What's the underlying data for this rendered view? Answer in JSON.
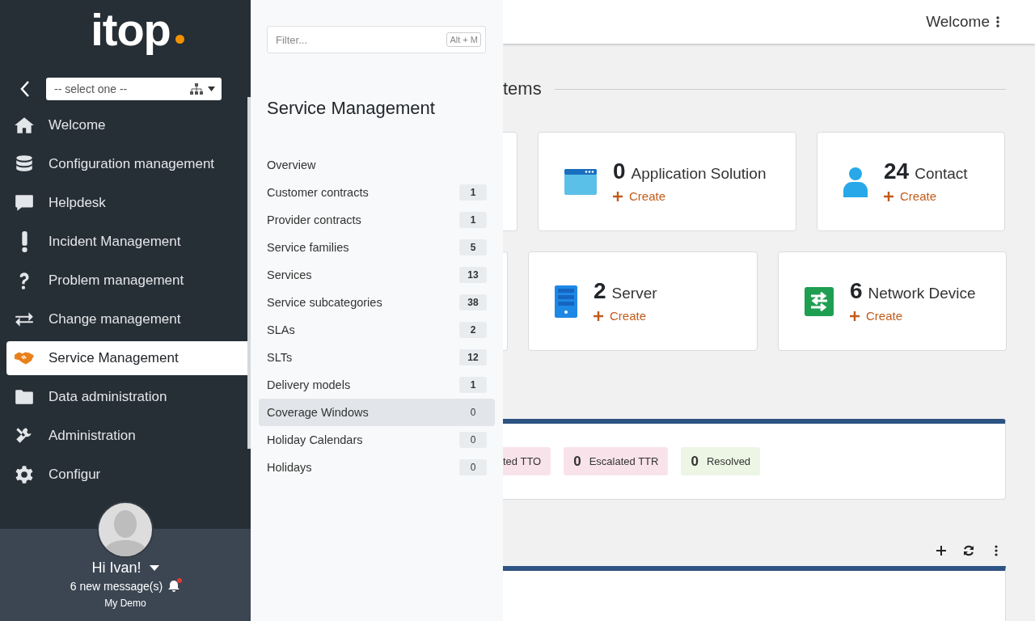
{
  "sidebar": {
    "logo": "itop",
    "org_select": {
      "value": "-- select one --"
    },
    "menu": [
      {
        "label": "Welcome",
        "selected": false
      },
      {
        "label": "Configuration management",
        "selected": false
      },
      {
        "label": "Helpdesk",
        "selected": false
      },
      {
        "label": "Incident Management",
        "selected": false
      },
      {
        "label": "Problem management",
        "selected": false
      },
      {
        "label": "Change management",
        "selected": false
      },
      {
        "label": "Service Management",
        "selected": true
      },
      {
        "label": "Data administration",
        "selected": false
      },
      {
        "label": "Administration",
        "selected": false
      },
      {
        "label": "Configur",
        "selected": false
      }
    ],
    "user": {
      "greeting": "Hi Ivan!",
      "messages": "6 new message(s)",
      "unread": true,
      "org": "My Demo"
    }
  },
  "flyout": {
    "filter": {
      "placeholder": "Filter...",
      "shortcut": "Alt + M"
    },
    "title": "Service Management",
    "items": [
      {
        "label": "Overview",
        "selected": false
      },
      {
        "label": "Customer contracts",
        "count": "1",
        "selected": false
      },
      {
        "label": "Provider contracts",
        "count": "1",
        "selected": false
      },
      {
        "label": "Service families",
        "count": "5",
        "selected": false
      },
      {
        "label": "Services",
        "count": "13",
        "selected": false
      },
      {
        "label": "Service subcategories",
        "count": "38",
        "selected": false
      },
      {
        "label": "SLAs",
        "count": "2",
        "selected": false
      },
      {
        "label": "SLTs",
        "count": "12",
        "selected": false
      },
      {
        "label": "Delivery models",
        "count": "1",
        "selected": false
      },
      {
        "label": "Coverage Windows",
        "count": "0",
        "selected": true
      },
      {
        "label": "Holiday Calendars",
        "count": "0",
        "selected": false
      },
      {
        "label": "Holidays",
        "count": "0",
        "selected": false
      }
    ]
  },
  "topbar": {
    "title": "Welcome"
  },
  "main": {
    "section_title": "tems",
    "card_rows": [
      [
        {
          "kind": "partial"
        },
        {
          "kind": "card",
          "count": "0",
          "label": "Application Solution",
          "action": "Create"
        },
        {
          "kind": "card",
          "count": "24",
          "label": "Contact",
          "action": "Create"
        }
      ],
      [
        {
          "kind": "partial"
        },
        {
          "kind": "card",
          "count": "2",
          "label": "Server",
          "action": "Create"
        },
        {
          "kind": "card",
          "count": "6",
          "label": "Network Device",
          "action": "Create"
        }
      ]
    ],
    "badges": [
      {
        "label": "ted TTO",
        "color": "#f9e3ea"
      },
      {
        "count": "0",
        "label": "Escalated TTR",
        "color": "#f9e3ea"
      },
      {
        "count": "0",
        "label": "Resolved",
        "color": "#edf6e5"
      }
    ]
  }
}
